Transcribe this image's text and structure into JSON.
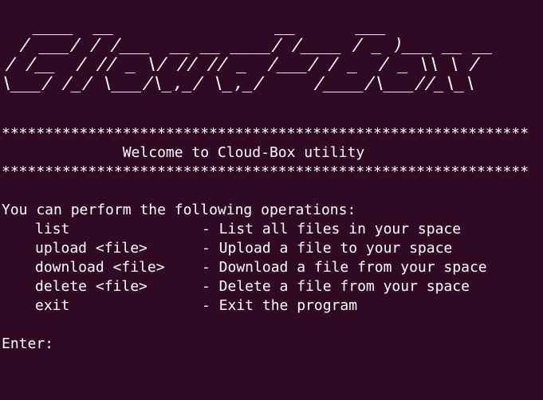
{
  "terminal": {
    "banner": "  ____  __                __      ___          \n / ___/ / /___  __ __ ____/ /____ / _ )___ __ __\n/ /__  / // _ \\/ // // _  /___/ / _  / _ \\\\ \\ /\n\\___/ /_/ \\___/\\_,_/ \\_,_/     /____/\\___//_\\_\\ ",
    "stars": "*************************************************************",
    "welcome": "              Welcome to Cloud-Box utility",
    "intro": "You can perform the following operations:",
    "operations": [
      {
        "command": "list",
        "description": "- List all files in your space"
      },
      {
        "command": "upload <file>",
        "description": "- Upload a file to your space"
      },
      {
        "command": "download <file>",
        "description": "- Download a file from your space"
      },
      {
        "command": "delete <file>",
        "description": "- Delete a file from your space"
      },
      {
        "command": "exit",
        "description": "- Exit the program"
      }
    ],
    "prompt": "Enter:",
    "colors": {
      "background": "#300a24",
      "foreground": "#ffffff"
    }
  }
}
